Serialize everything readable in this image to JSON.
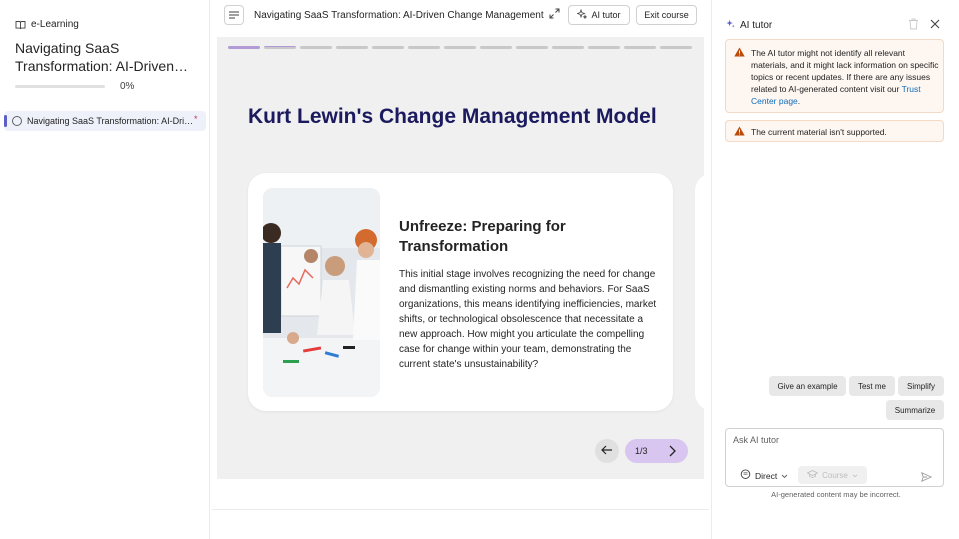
{
  "sidebar": {
    "app_name": "e-Learning",
    "course_title": "Navigating SaaS Transformation: AI-Driven…",
    "progress_pct": "0%",
    "progress_value": 0,
    "items": [
      {
        "label": "Navigating SaaS Transformation: AI-Dri…",
        "marker": "*"
      }
    ]
  },
  "header": {
    "title": "Navigating SaaS Transformation: AI-Driven Change Management",
    "ai_tutor_label": "AI tutor",
    "exit_label": "Exit course"
  },
  "slide": {
    "title": "Kurt Lewin's Change Management Model",
    "card_heading": "Unfreeze: Preparing for Transformation",
    "card_body": "This initial stage involves recognizing the need for change and dismantling existing norms and behaviors. For SaaS organizations, this means identifying inefficiencies, market shifts, or technological obsolescence that necessitate a new approach. How might you articulate the compelling case for change within your team, demonstrating the current state's unsustainability?",
    "counter": "1/3",
    "segments_total": 13,
    "segments_done": 1,
    "segment_current": 2
  },
  "panel": {
    "title": "AI tutor",
    "warning1_text": "The AI tutor might not identify all relevant materials, and it might lack information on specific topics or recent updates. If there are any issues related to AI-generated content visit our ",
    "warning1_link": "Trust Center page",
    "warning1_end": ".",
    "warning2_text": "The current material isn't supported.",
    "chips": {
      "example": "Give an example",
      "test": "Test me",
      "simplify": "Simplify",
      "summarize": "Summarize"
    },
    "ask_placeholder": "Ask AI tutor",
    "mode_label": "Direct",
    "course_label": "Course",
    "disclaimer": "AI-generated content may be incorrect."
  },
  "colors": {
    "accent": "#5b5fc7",
    "slide_title": "#1b1a5e",
    "progress_done": "#b29ad6",
    "pill": "#d9c6f0",
    "warning_icon": "#bc4b09",
    "link": "#0f6cbd"
  }
}
